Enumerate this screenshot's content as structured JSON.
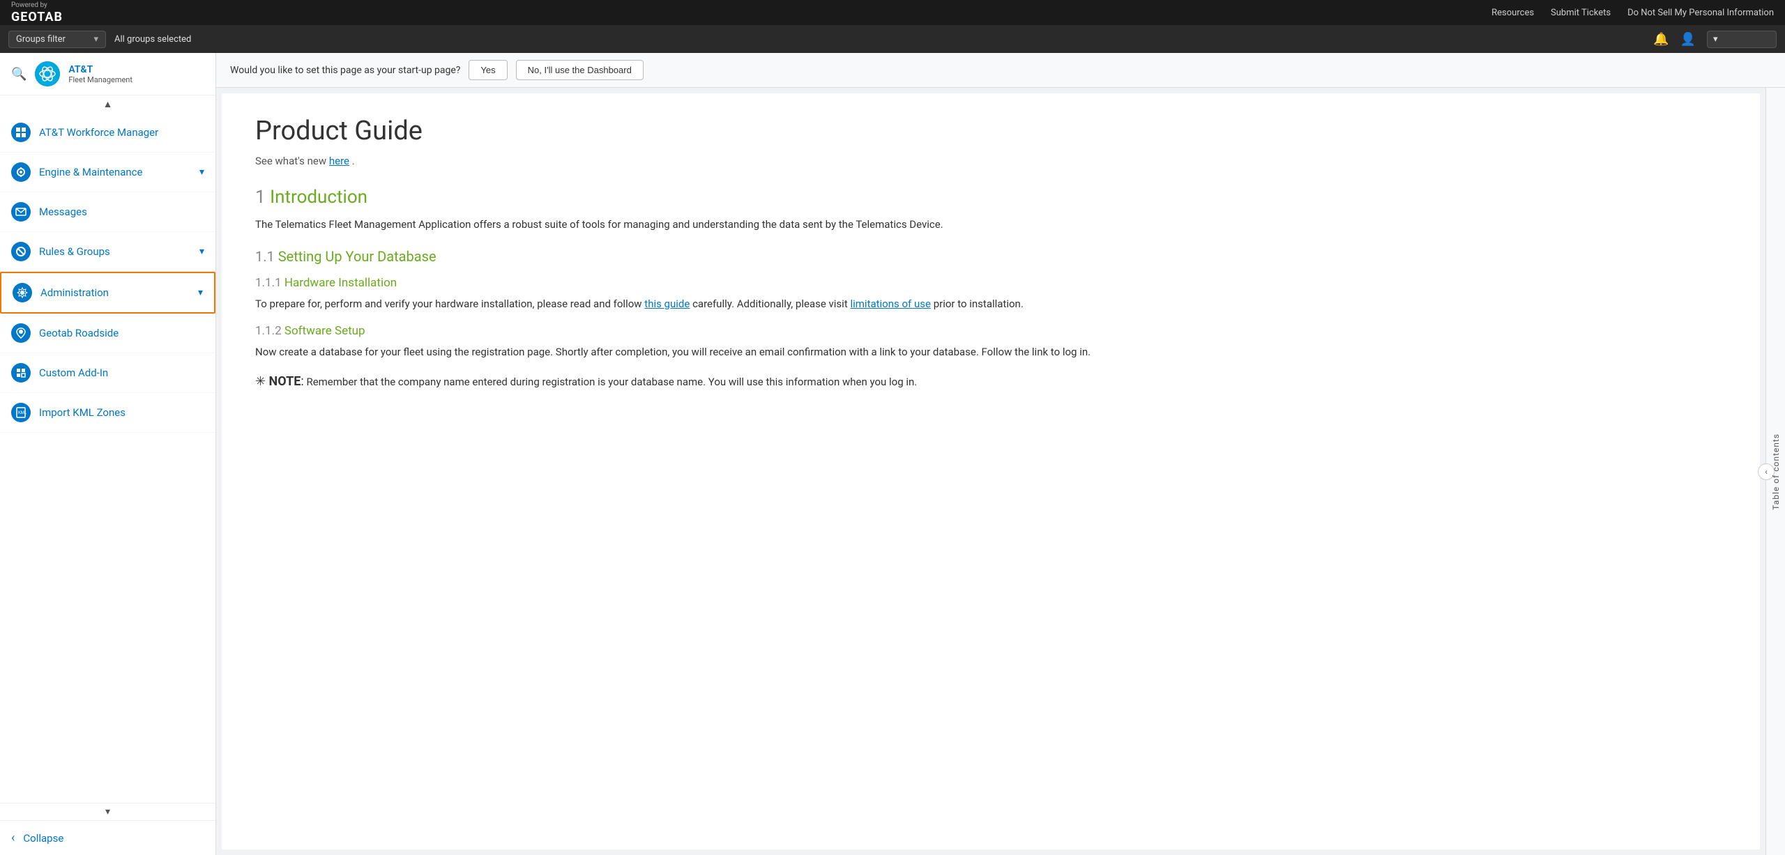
{
  "topbar": {
    "powered_by": "Powered by",
    "logo_text": "GEOTAB",
    "links": [
      {
        "id": "resources",
        "label": "Resources"
      },
      {
        "id": "submit-tickets",
        "label": "Submit Tickets"
      },
      {
        "id": "do-not-sell",
        "label": "Do Not Sell My Personal Information"
      }
    ]
  },
  "filterbar": {
    "groups_filter_label": "Groups filter",
    "all_groups_text": "All groups selected",
    "chevron": "▾"
  },
  "sidebar": {
    "company_name": "AT&T",
    "company_subtitle": "Fleet Management",
    "nav_items": [
      {
        "id": "att-workforce",
        "label": "AT&T Workforce Manager",
        "icon": "grid",
        "has_chevron": false
      },
      {
        "id": "engine-maintenance",
        "label": "Engine & Maintenance",
        "icon": "gauge",
        "has_chevron": true
      },
      {
        "id": "messages",
        "label": "Messages",
        "icon": "envelope",
        "has_chevron": false
      },
      {
        "id": "rules-groups",
        "label": "Rules & Groups",
        "icon": "circle-slash",
        "has_chevron": true
      },
      {
        "id": "administration",
        "label": "Administration",
        "icon": "gear",
        "has_chevron": true,
        "active": true
      },
      {
        "id": "geotab-roadside",
        "label": "Geotab Roadside",
        "icon": "roadside",
        "has_chevron": false
      },
      {
        "id": "custom-add-in",
        "label": "Custom Add-In",
        "icon": "puzzle",
        "has_chevron": false
      },
      {
        "id": "import-kml-zones",
        "label": "Import KML Zones",
        "icon": "kml",
        "has_chevron": false
      }
    ],
    "collapse_label": "Collapse"
  },
  "startup_bar": {
    "question": "Would you like to set this page as your start-up page?",
    "yes_label": "Yes",
    "no_label": "No, I'll use the Dashboard"
  },
  "doc": {
    "title": "Product Guide",
    "subtitle_text": "See what's new ",
    "subtitle_link": "here",
    "subtitle_after": ".",
    "sections": [
      {
        "num": "1",
        "title": "Introduction",
        "body": "The Telematics Fleet Management Application offers a robust suite of tools for managing and understanding the data sent by the Telematics Device.",
        "subsections": [
          {
            "num": "1.1",
            "title": "Setting Up Your Database",
            "subsubsections": [
              {
                "num": "1.1.1",
                "title": "Hardware Installation",
                "body_before": "To prepare for, perform and verify your hardware installation, please read and follow ",
                "link1_text": "this guide",
                "body_middle": " carefully. Additionally, please visit ",
                "link2_text": "limitations of use",
                "body_after": " prior to installation."
              },
              {
                "num": "1.1.2",
                "title": "Software Setup",
                "body": "Now create a database for your fleet using the registration page. Shortly after completion, you will receive an email confirmation with a link to your database. Follow the link to log in.",
                "note": "NOTE: Remember that the company name entered during registration is your database name. You will use this information when you log in."
              }
            ]
          }
        ]
      }
    ]
  },
  "toc": {
    "label": "Table of contents"
  }
}
